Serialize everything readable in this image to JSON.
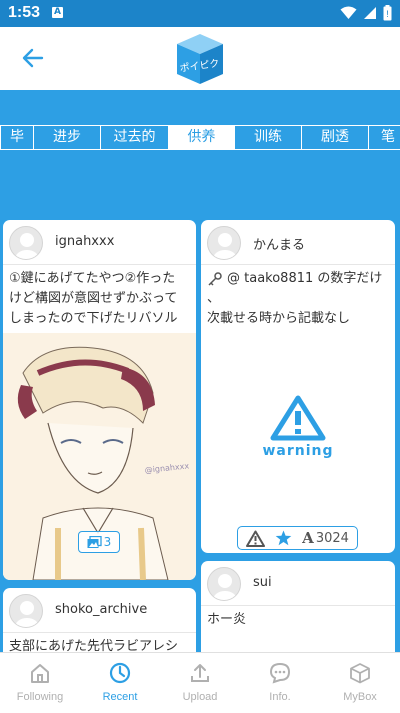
{
  "status_bar": {
    "time": "1:53",
    "notification_letter": "A"
  },
  "header": {
    "logo_text": "ポイピク"
  },
  "tabs": [
    "毕",
    "进步",
    "过去的",
    "供养",
    "训练",
    "剧透",
    "笔"
  ],
  "active_tab": "供养",
  "posts": [
    {
      "username": "ignahxxx",
      "text": "①鍵にあげてたやつ②作ったけど構図が意図せずかぶってしまったので下げたリバソル",
      "image_count": "3",
      "image_signature": "@ignahxxx"
    },
    {
      "username": "かんまる",
      "text": "@ taako8811 の数字だけ\n、\n次載せる時から記載なし",
      "warning_label": "warning",
      "reaction_count": "3024"
    },
    {
      "username": "shoko_archive",
      "text": "支部にあげた先代ラビアレシ"
    },
    {
      "username": "sui",
      "text": "ホー炎"
    }
  ],
  "bottom_nav": [
    {
      "label": "Following",
      "icon": "home-icon"
    },
    {
      "label": "Recent",
      "icon": "clock-icon"
    },
    {
      "label": "Upload",
      "icon": "upload-icon"
    },
    {
      "label": "Info.",
      "icon": "chat-icon"
    },
    {
      "label": "MyBox",
      "icon": "box-icon"
    }
  ],
  "active_nav": "Recent",
  "colors": {
    "primary": "#2d9fe4",
    "status_bar": "#1c84c9",
    "inactive": "#b0b0b0"
  }
}
